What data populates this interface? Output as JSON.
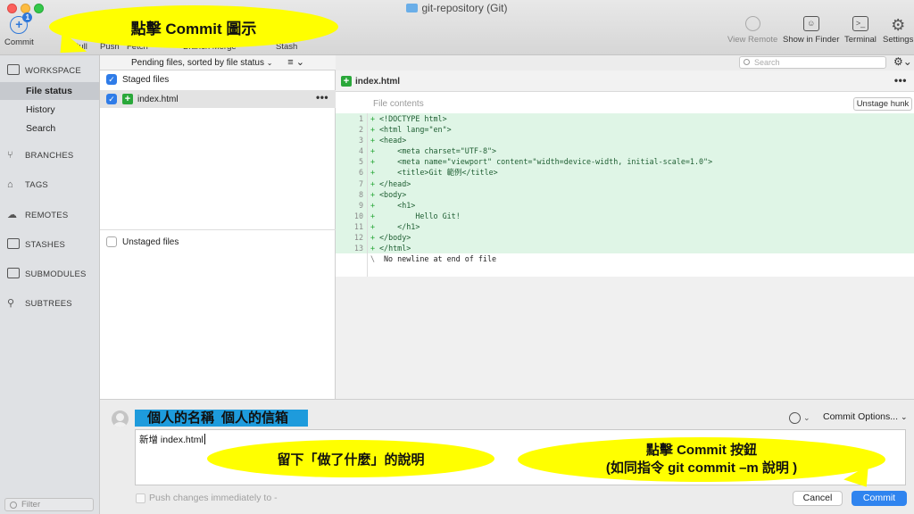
{
  "window": {
    "title": "git-repository (Git)"
  },
  "toolbar": {
    "commit_label": "Commit",
    "commit_badge": "1",
    "pull_label": "Pull",
    "push_label": "Push",
    "fetch_label": "Fetch",
    "branch_merge_label": "Branch  Merge",
    "stash_label": "Stash",
    "view_remote_label": "View Remote",
    "show_finder_label": "Show in Finder",
    "terminal_label": "Terminal",
    "settings_label": "Settings"
  },
  "sidebar": {
    "workspace": "WORKSPACE",
    "items": [
      "File status",
      "History",
      "Search"
    ],
    "sections": [
      "BRANCHES",
      "TAGS",
      "REMOTES",
      "STASHES",
      "SUBMODULES",
      "SUBTREES"
    ],
    "filter_placeholder": "Filter"
  },
  "filelist": {
    "sort_label": "Pending files, sorted by file status",
    "staged_label": "Staged files",
    "file_name": "index.html",
    "unstaged_label": "Unstaged files"
  },
  "diff": {
    "search_placeholder": "Search",
    "file_name": "index.html",
    "file_contents_label": "File contents",
    "unstage_hunk_label": "Unstage hunk",
    "lines": [
      {
        "n": "1",
        "s": "+",
        "t": "<!DOCTYPE html>"
      },
      {
        "n": "2",
        "s": "+",
        "t": "<html lang=\"en\">"
      },
      {
        "n": "3",
        "s": "+",
        "t": "<head>"
      },
      {
        "n": "4",
        "s": "+",
        "t": "    <meta charset=\"UTF-8\">"
      },
      {
        "n": "5",
        "s": "+",
        "t": "    <meta name=\"viewport\" content=\"width=device-width, initial-scale=1.0\">"
      },
      {
        "n": "6",
        "s": "+",
        "t": "    <title>Git 範例</title>"
      },
      {
        "n": "7",
        "s": "+",
        "t": "</head>"
      },
      {
        "n": "8",
        "s": "+",
        "t": "<body>"
      },
      {
        "n": "9",
        "s": "+",
        "t": "    <h1>"
      },
      {
        "n": "10",
        "s": "+",
        "t": "        Hello Git!"
      },
      {
        "n": "11",
        "s": "+",
        "t": "    </h1>"
      },
      {
        "n": "12",
        "s": "+",
        "t": "</body>"
      },
      {
        "n": "13",
        "s": "+",
        "t": "</html>"
      }
    ],
    "no_newline": "No newline at end of file"
  },
  "commit": {
    "author_name": "個人的名稱",
    "author_email": "個人的信箱",
    "message": "新增 index.html",
    "options_label": "Commit Options...",
    "push_label": "Push changes immediately to -",
    "cancel_label": "Cancel",
    "commit_label": "Commit"
  },
  "callouts": {
    "top": "點擊 Commit 圖示",
    "mid": "留下「做了什麼」的說明",
    "right_line1": "點擊 Commit 按鈕",
    "right_line2": "(如同指令 git commit –m 說明 )"
  },
  "colors": {
    "accent": "#2f84ef",
    "added_bg": "#dff5e6",
    "callout": "#ffff00",
    "author_bg": "#1e9bdc"
  }
}
